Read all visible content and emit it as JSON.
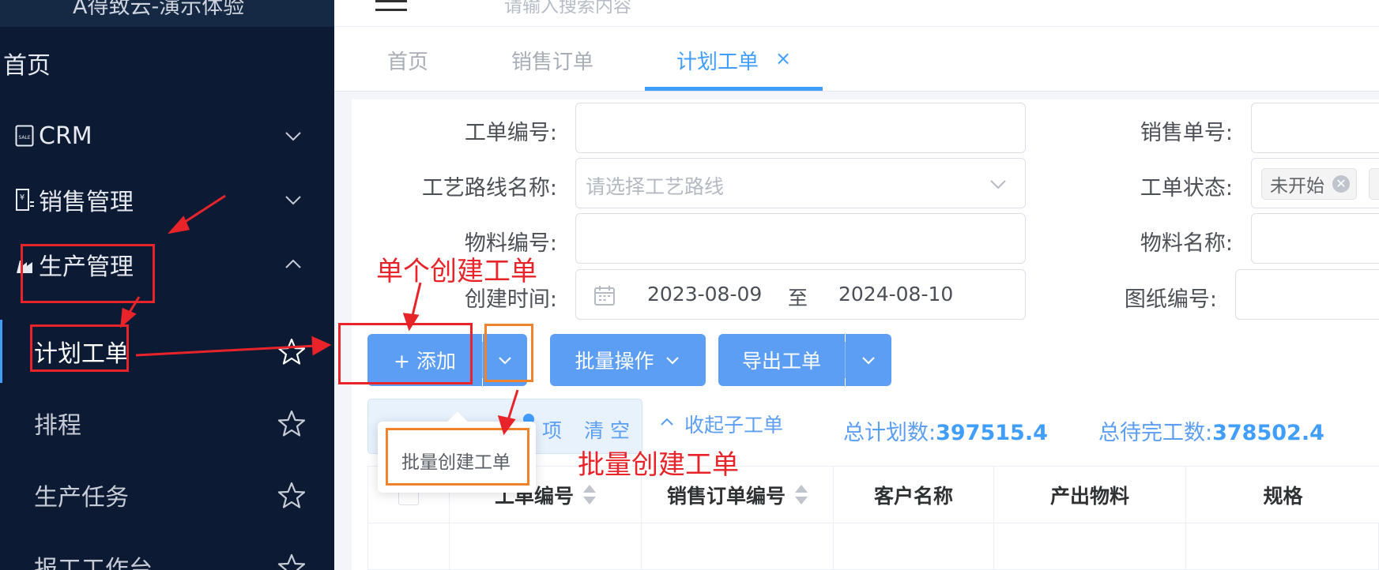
{
  "sidebar": {
    "brand": "A得致云-演示体验",
    "items": [
      {
        "label": "首页"
      },
      {
        "label": "CRM"
      },
      {
        "label": "销售管理"
      },
      {
        "label": "生产管理"
      }
    ],
    "subitems": [
      {
        "label": "计划工单"
      },
      {
        "label": "排程"
      },
      {
        "label": "生产任务"
      },
      {
        "label": "报工工作台"
      }
    ]
  },
  "header": {
    "search_placeholder": "请输入搜索内容"
  },
  "tabs": [
    {
      "label": "首页"
    },
    {
      "label": "销售订单"
    },
    {
      "label": "计划工单",
      "close": "×"
    }
  ],
  "form": {
    "work_order_no": {
      "label": "工单编号:"
    },
    "sales_order_no": {
      "label": "销售单号:"
    },
    "route_name": {
      "label": "工艺路线名称:",
      "placeholder": "请选择工艺路线"
    },
    "status": {
      "label": "工单状态:",
      "tag": "未开始"
    },
    "material_no": {
      "label": "物料编号:"
    },
    "material_name": {
      "label": "物料名称:"
    },
    "created_time": {
      "label": "创建时间:",
      "start": "2023-08-09",
      "sep": "至",
      "end": "2024-08-10"
    },
    "drawing_no": {
      "label": "图纸编号:"
    }
  },
  "toolbar": {
    "add": "+ 添加",
    "batch": "批量操作",
    "export": "导出工单"
  },
  "dropdown": {
    "item": "批量创建工单"
  },
  "info": {
    "selected_suffix": "项",
    "clear": "清 空",
    "collapse": "收起子工单",
    "total_plan_label": "总计划数:",
    "total_plan_value": "397515.4",
    "total_pending_label": "总待完工数:",
    "total_pending_value": "378502.4"
  },
  "table": {
    "columns": [
      "工单编号",
      "销售订单编号",
      "客户名称",
      "产出物料",
      "规格"
    ]
  },
  "annotations": {
    "single_create": "单个创建工单",
    "batch_create": "批量创建工单"
  },
  "colors": {
    "sidebar_bg": "#0c1a33",
    "accent": "#409eff",
    "button": "#5b9ef3",
    "annotation_red": "#e8242a",
    "annotation_orange": "#f1822c"
  }
}
